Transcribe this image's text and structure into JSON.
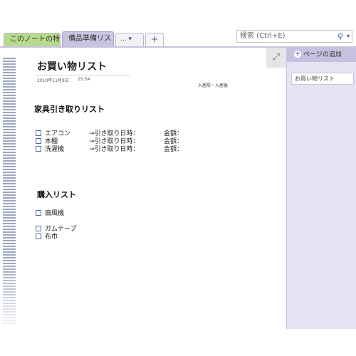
{
  "tabs": {
    "section1": "このノートの特長",
    "section2": "備品準備リスト",
    "more": "... ▾",
    "add": "+"
  },
  "search": {
    "placeholder": "検索 (Ctrl+E)"
  },
  "right_pane": {
    "add_page": "ページの追加",
    "pages": [
      "お買い物リスト"
    ]
  },
  "page": {
    "title": "お買い物リスト",
    "date": "2010年11月9日",
    "time": "15:54",
    "note": "入居前・入居後",
    "section1": {
      "heading": "家具引き取りリスト",
      "items": [
        {
          "name": "エアコン",
          "pickup": "→引き取り日時：",
          "price": "金額："
        },
        {
          "name": "本棚",
          "pickup": "→引き取り日時：",
          "price": "金額："
        },
        {
          "name": "洗濯機",
          "pickup": "→引き取り日時：",
          "price": "金額："
        }
      ]
    },
    "section2": {
      "heading": "購入リスト",
      "items": [
        "扇風機",
        "ガムテープ",
        "布巾"
      ]
    }
  },
  "colors": {
    "section_tab_green": "#b6d98c",
    "section_tab_purple": "#c9c3e0",
    "right_pane_bg": "#e6e2f2"
  }
}
